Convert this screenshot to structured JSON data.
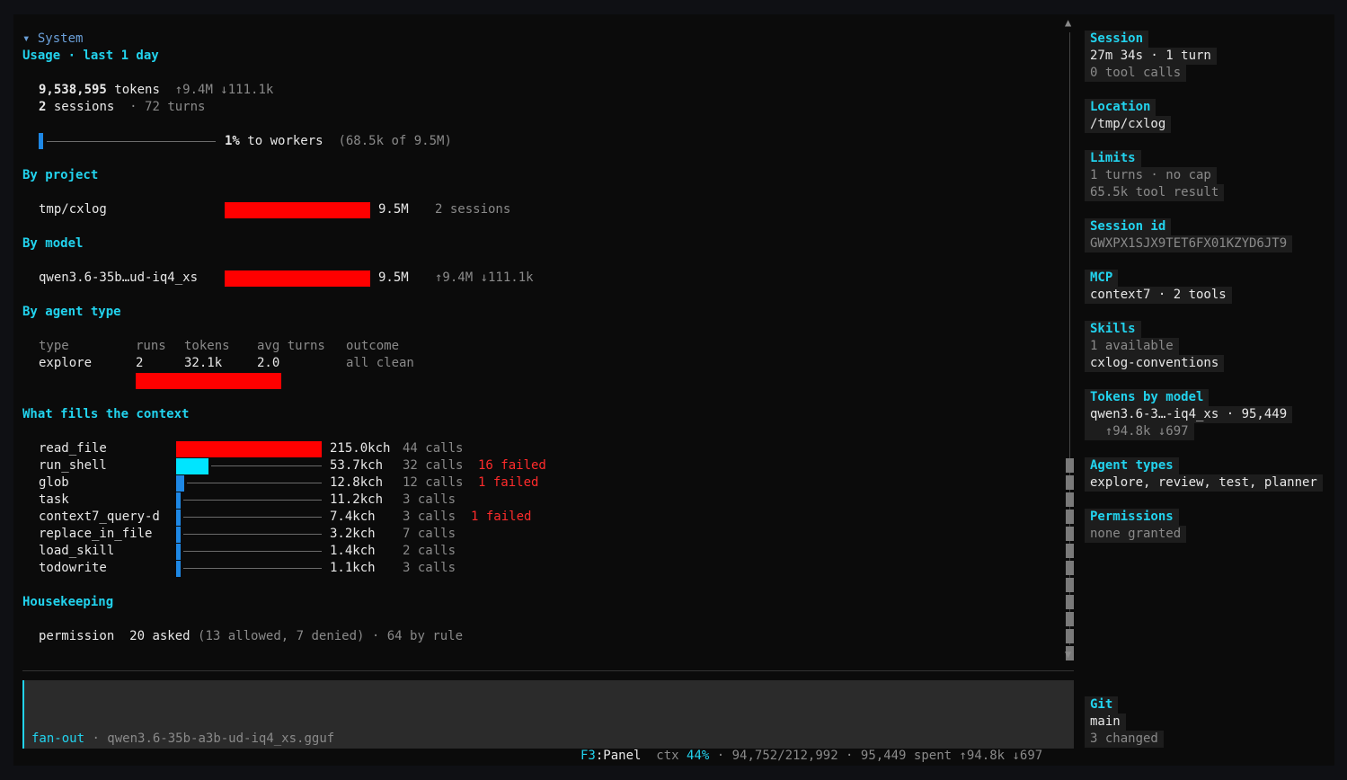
{
  "main": {
    "system_toggle": "▾ System",
    "usage_title": "Usage · last 1 day",
    "tokens_value": "9,538,595",
    "tokens_label": "tokens",
    "tokens_io": "↑9.4M ↓111.1k",
    "sessions_value": "2",
    "sessions_label": "sessions",
    "turns_text": "· 72 turns",
    "workers_pct": "1%",
    "workers_label": "to workers",
    "workers_detail": "(68.5k of 9.5M)",
    "workers_fraction": 0.01,
    "by_project_title": "By project",
    "projects": [
      {
        "name": "tmp/cxlog",
        "value": "9.5M",
        "detail": "2 sessions",
        "fraction": 1.0
      }
    ],
    "by_model_title": "By model",
    "models": [
      {
        "name": "qwen3.6-35b…ud-iq4_xs",
        "value": "9.5M",
        "detail": "↑9.4M ↓111.1k",
        "fraction": 1.0
      }
    ],
    "by_agent_title": "By agent type",
    "agent_headers": {
      "type": "type",
      "runs": "runs",
      "tokens": "tokens",
      "avg_turns": "avg turns",
      "outcome": "outcome"
    },
    "agents": [
      {
        "type": "explore",
        "runs": "2",
        "tokens": "32.1k",
        "avg_turns": "2.0",
        "outcome": "all clean",
        "fraction": 1.0
      }
    ],
    "context_title": "What fills the context",
    "tools": [
      {
        "name": "read_file",
        "value": "215.0kch",
        "calls": "44 calls",
        "failed": "",
        "fraction": 1.0,
        "color": "#ff0000"
      },
      {
        "name": "run_shell",
        "value": "53.7kch",
        "calls": "32 calls",
        "failed": "16 failed",
        "fraction": 0.2225,
        "color": "#00e5ff"
      },
      {
        "name": "glob",
        "value": "12.8kch",
        "calls": "12 calls",
        "failed": "1 failed",
        "fraction": 0.055,
        "color": "#1e88e5"
      },
      {
        "name": "task",
        "value": "11.2kch",
        "calls": "3 calls",
        "failed": "",
        "fraction": 0.025,
        "color": "#1e88e5"
      },
      {
        "name": "context7_query-d",
        "value": "7.4kch",
        "calls": "3 calls",
        "failed": "1 failed",
        "fraction": 0.025,
        "color": "#1e88e5"
      },
      {
        "name": "replace_in_file",
        "value": "3.2kch",
        "calls": "7 calls",
        "failed": "",
        "fraction": 0.025,
        "color": "#1e88e5"
      },
      {
        "name": "load_skill",
        "value": "1.4kch",
        "calls": "2 calls",
        "failed": "",
        "fraction": 0.025,
        "color": "#1e88e5"
      },
      {
        "name": "todowrite",
        "value": "1.1kch",
        "calls": "3 calls",
        "failed": "",
        "fraction": 0.025,
        "color": "#1e88e5"
      }
    ],
    "housekeeping_title": "Housekeeping",
    "permission_label": "permission",
    "permission_asked": "20 asked",
    "permission_detail": "(13 allowed, 7 denied) · 64 by rule"
  },
  "scroll": {
    "up": "▲",
    "down": "▼"
  },
  "input": {
    "mode": "fan-out",
    "model": "· qwen3.6-35b-a3b-ud-iq4_xs.gguf"
  },
  "statusbar": {
    "key": "F3",
    "key_label": ":Panel",
    "ctx_label": "ctx",
    "ctx_pct": "44%",
    "rest": "· 94,752/212,992 · 95,449 spent ↑94.8k ↓697"
  },
  "sidebar": {
    "session_title": "Session",
    "session_line1": "27m 34s · 1 turn",
    "session_line2": "0 tool calls",
    "location_title": "Location",
    "location_line1": "/tmp/cxlog",
    "limits_title": "Limits",
    "limits_line1": "1 turns · no cap",
    "limits_line2": "65.5k tool result",
    "sessionid_title": "Session id",
    "sessionid_line1": "GWXPX1SJX9TET6FX01KZYD6JT9",
    "mcp_title": "MCP",
    "mcp_line1": "context7 · 2 tools",
    "skills_title": "Skills",
    "skills_line1": "1 available",
    "skills_line2": "cxlog-conventions",
    "tbm_title": "Tokens by model",
    "tbm_line1": "qwen3.6-3…-iq4_xs · 95,449",
    "tbm_line2": "  ↑94.8k ↓697",
    "agenttypes_title": "Agent types",
    "agenttypes_line1": "explore, review, test, planner",
    "permissions_title": "Permissions",
    "permissions_line1": "none granted",
    "git_title": "Git",
    "git_line1": "main",
    "git_line2": "3 changed"
  }
}
